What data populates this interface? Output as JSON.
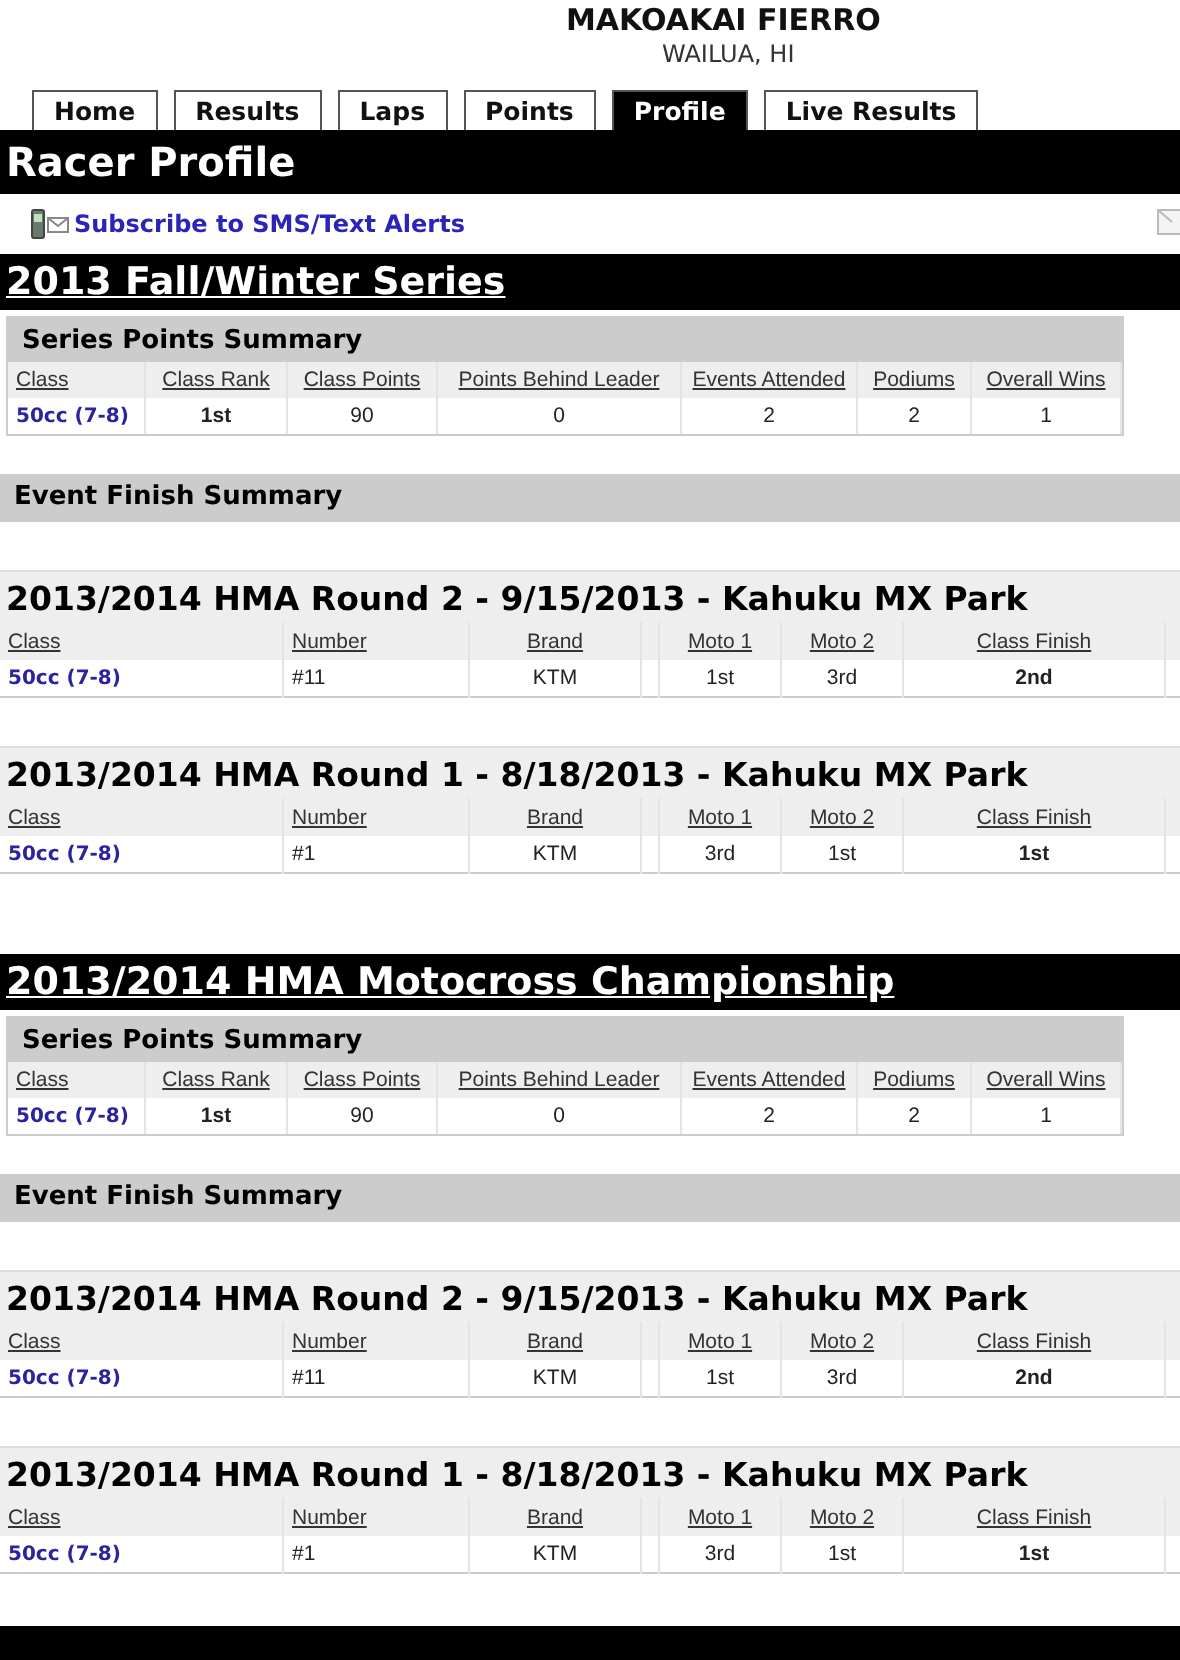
{
  "header": {
    "name": "MAKOAKAI FIERRO",
    "location": "WAILUA, HI"
  },
  "tabs": [
    {
      "label": "Home",
      "selected": false
    },
    {
      "label": "Results",
      "selected": false
    },
    {
      "label": "Laps",
      "selected": false
    },
    {
      "label": "Points",
      "selected": false
    },
    {
      "label": "Profile",
      "selected": true
    },
    {
      "label": "Live Results",
      "selected": false
    }
  ],
  "page_title": "Racer Profile",
  "sms_link": "Subscribe to SMS/Text Alerts",
  "series": [
    {
      "title": "2013 Fall/Winter Series",
      "points_summary": {
        "title": "Series Points  Summary",
        "columns": [
          {
            "label": "Class",
            "kind": "link"
          },
          {
            "label": "Class Rank",
            "kind": "bold"
          },
          {
            "label": "Class Points",
            "kind": "plain"
          },
          {
            "label": "Points Behind Leader",
            "kind": "plain"
          },
          {
            "label": "Events Attended",
            "kind": "plain"
          },
          {
            "label": "Podiums",
            "kind": "plain"
          },
          {
            "label": "Overall Wins",
            "kind": "plain"
          }
        ],
        "rows": [
          [
            "50cc (7-8)",
            "1st",
            "90",
            "0",
            "2",
            "2",
            "1"
          ]
        ]
      },
      "event_finish_title": "Event Finish Summary",
      "events": [
        {
          "title": "2013/2014 HMA Round 2 - 9/15/2013 - Kahuku MX Park",
          "columns": [
            {
              "label": "Class",
              "kind": "link"
            },
            {
              "label": "Number",
              "kind": "left"
            },
            {
              "label": "Brand",
              "kind": "plain"
            },
            {
              "kind": "spacer"
            },
            {
              "label": "Moto 1",
              "kind": "plain"
            },
            {
              "label": "Moto 2",
              "kind": "plain"
            },
            {
              "label": "Class Finish",
              "kind": "bold"
            },
            {
              "kind": "spacer"
            }
          ],
          "rows": [
            [
              "50cc (7-8)",
              "#11",
              "KTM",
              "",
              "1st",
              "3rd",
              "2nd",
              ""
            ]
          ]
        },
        {
          "title": "2013/2014 HMA Round 1 - 8/18/2013 - Kahuku MX Park",
          "columns": [
            {
              "label": "Class",
              "kind": "link"
            },
            {
              "label": "Number",
              "kind": "left"
            },
            {
              "label": "Brand",
              "kind": "plain"
            },
            {
              "kind": "spacer"
            },
            {
              "label": "Moto 1",
              "kind": "plain"
            },
            {
              "label": "Moto 2",
              "kind": "plain"
            },
            {
              "label": "Class Finish",
              "kind": "bold"
            },
            {
              "kind": "spacer"
            }
          ],
          "rows": [
            [
              "50cc (7-8)",
              "#1",
              "KTM",
              "",
              "3rd",
              "1st",
              "1st",
              ""
            ]
          ]
        }
      ]
    },
    {
      "title": "2013/2014 HMA Motocross Championship",
      "points_summary": {
        "title": "Series Points  Summary",
        "columns": [
          {
            "label": "Class",
            "kind": "link"
          },
          {
            "label": "Class Rank",
            "kind": "bold"
          },
          {
            "label": "Class Points",
            "kind": "plain"
          },
          {
            "label": "Points Behind Leader",
            "kind": "plain"
          },
          {
            "label": "Events Attended",
            "kind": "plain"
          },
          {
            "label": "Podiums",
            "kind": "plain"
          },
          {
            "label": "Overall Wins",
            "kind": "plain"
          }
        ],
        "rows": [
          [
            "50cc (7-8)",
            "1st",
            "90",
            "0",
            "2",
            "2",
            "1"
          ]
        ]
      },
      "event_finish_title": "Event Finish Summary",
      "events": [
        {
          "title": "2013/2014 HMA Round 2 - 9/15/2013 - Kahuku MX Park",
          "columns": [
            {
              "label": "Class",
              "kind": "link"
            },
            {
              "label": "Number",
              "kind": "left"
            },
            {
              "label": "Brand",
              "kind": "plain"
            },
            {
              "kind": "spacer"
            },
            {
              "label": "Moto 1",
              "kind": "plain"
            },
            {
              "label": "Moto 2",
              "kind": "plain"
            },
            {
              "label": "Class Finish",
              "kind": "bold"
            },
            {
              "kind": "spacer"
            }
          ],
          "rows": [
            [
              "50cc (7-8)",
              "#11",
              "KTM",
              "",
              "1st",
              "3rd",
              "2nd",
              ""
            ]
          ]
        },
        {
          "title": "2013/2014 HMA Round 1 - 8/18/2013 - Kahuku MX Park",
          "columns": [
            {
              "label": "Class",
              "kind": "link"
            },
            {
              "label": "Number",
              "kind": "left"
            },
            {
              "label": "Brand",
              "kind": "plain"
            },
            {
              "kind": "spacer"
            },
            {
              "label": "Moto 1",
              "kind": "plain"
            },
            {
              "label": "Moto 2",
              "kind": "plain"
            },
            {
              "label": "Class Finish",
              "kind": "bold"
            },
            {
              "kind": "spacer"
            }
          ],
          "rows": [
            [
              "50cc (7-8)",
              "#1",
              "KTM",
              "",
              "3rd",
              "1st",
              "1st",
              ""
            ]
          ]
        }
      ]
    }
  ]
}
